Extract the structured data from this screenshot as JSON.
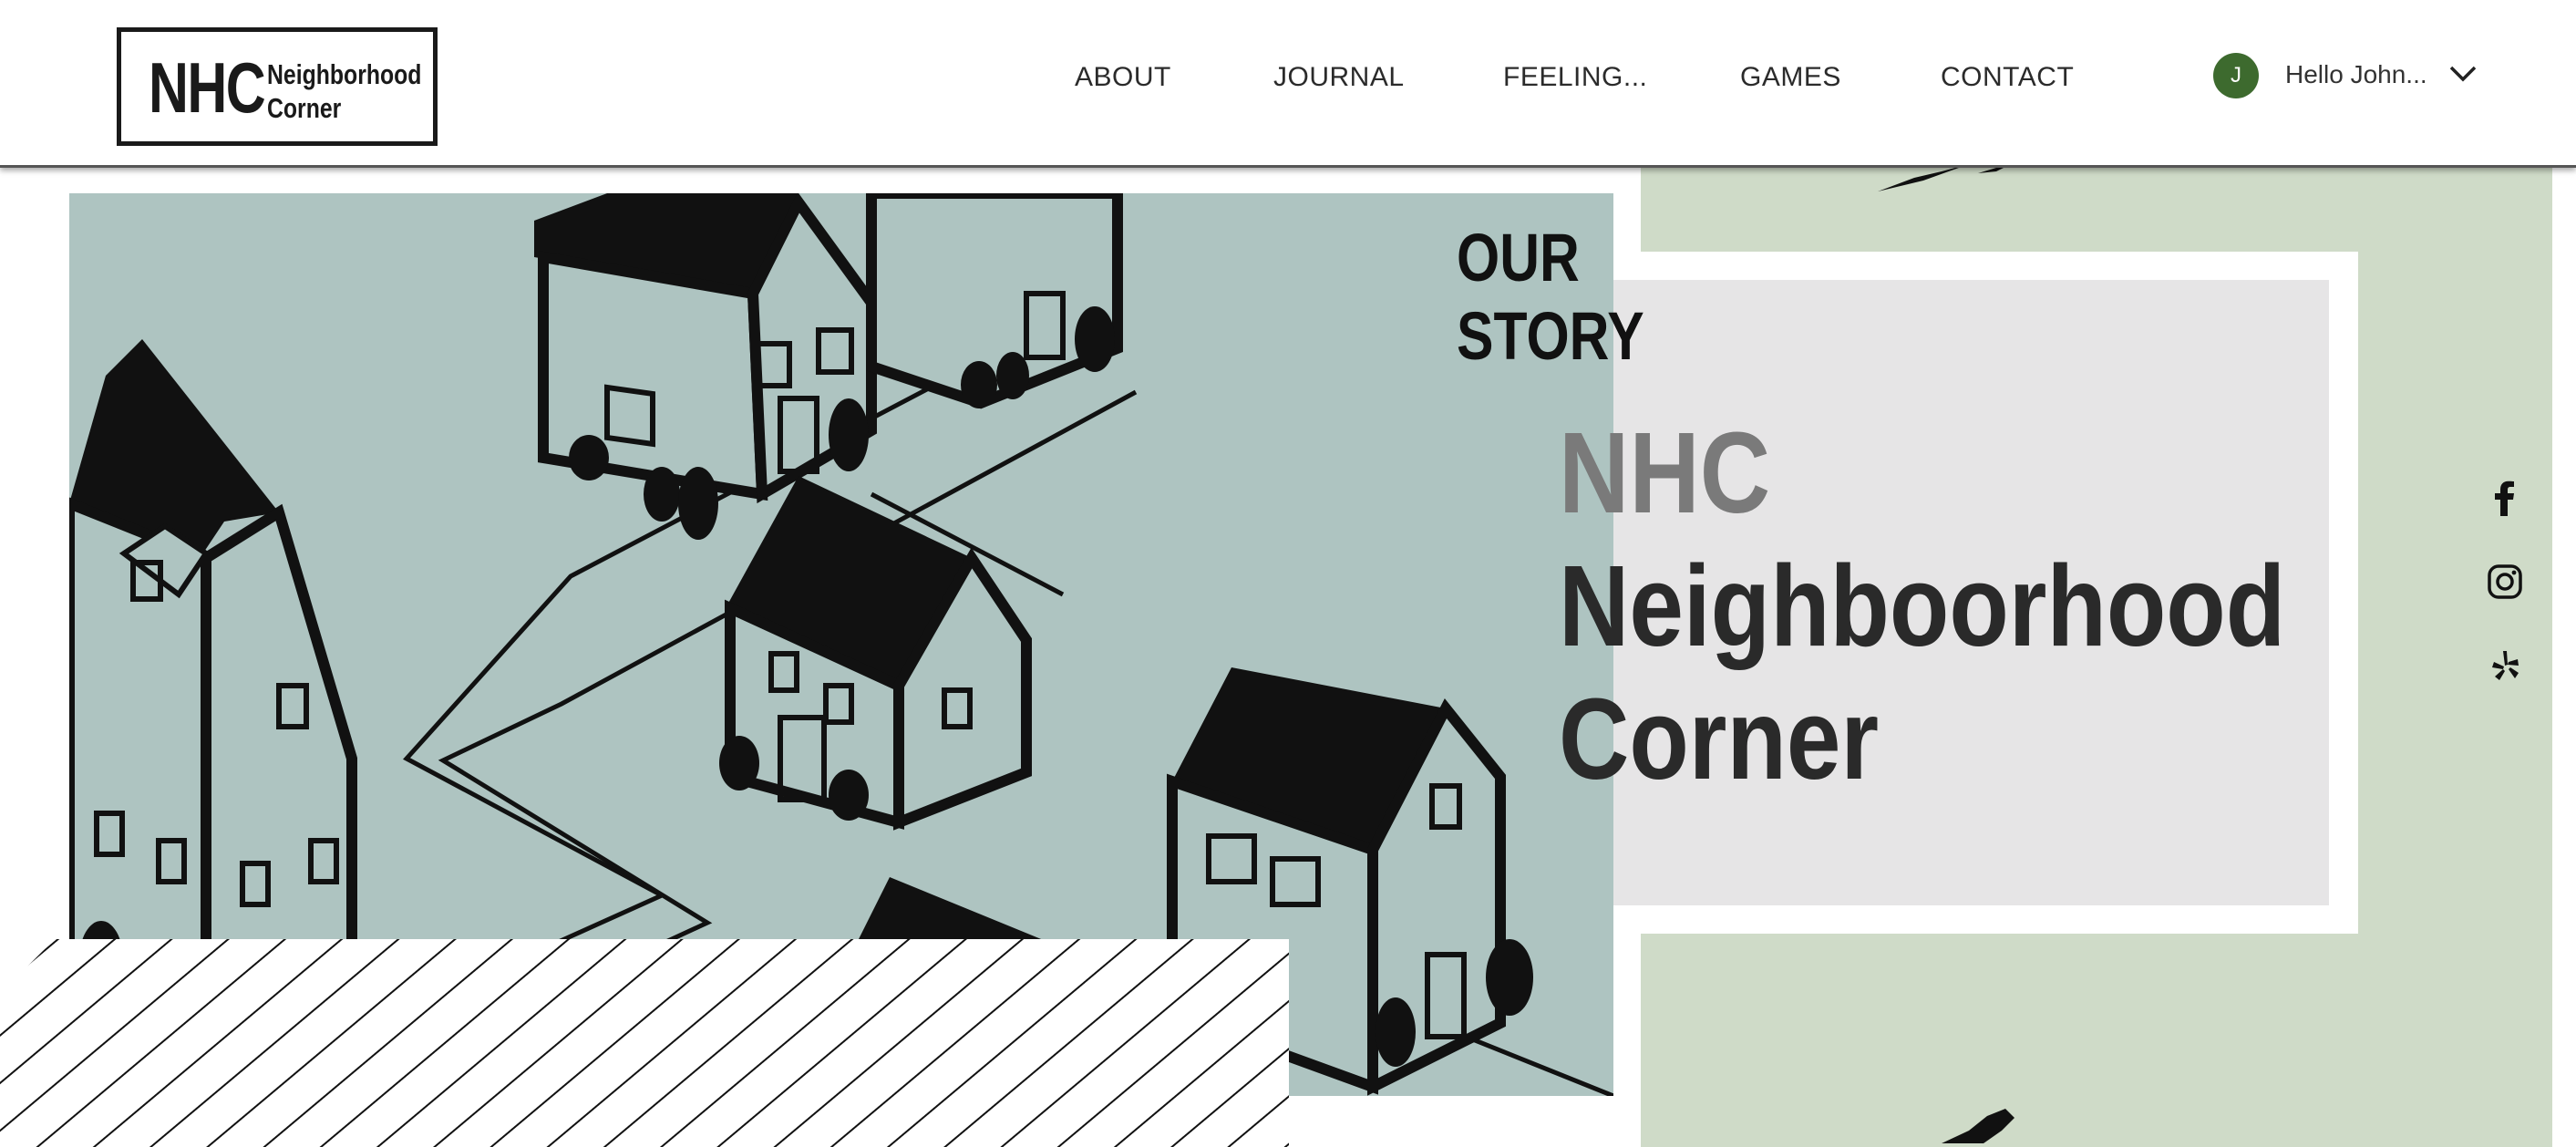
{
  "header": {
    "logo": {
      "abbr": "NHC",
      "line1": "Neighborhood",
      "line2": "Corner"
    },
    "nav": [
      {
        "label": "ABOUT"
      },
      {
        "label": "JOURNAL"
      },
      {
        "label": "FEELING..."
      },
      {
        "label": "GAMES"
      },
      {
        "label": "CONTACT"
      }
    ],
    "user": {
      "avatar_initial": "J",
      "greeting": "Hello John...",
      "avatar_color": "#3d6a2e"
    }
  },
  "hero": {
    "section_label_line1": "OUR",
    "section_label_line2": "STORY",
    "title_abbr": "NHC",
    "title_line1": "Neighboorhood",
    "title_line2": "Corner",
    "illustration": "neighborhood-houses-illustration"
  },
  "social": [
    {
      "icon": "facebook-icon"
    },
    {
      "icon": "instagram-icon"
    },
    {
      "icon": "yelp-icon"
    }
  ],
  "colors": {
    "illustration_bg": "#aec4c1",
    "side_bg": "#cfdbc8",
    "panel_bg": "#e6e5e6",
    "avatar": "#3d6a2e"
  }
}
